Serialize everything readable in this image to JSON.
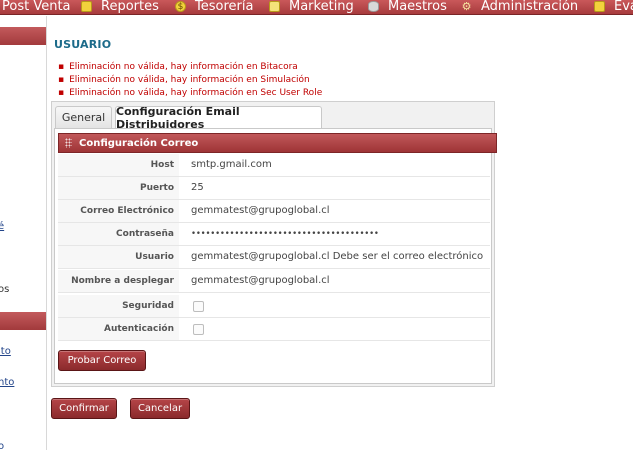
{
  "menu": {
    "items": [
      {
        "label": "Post Venta",
        "icon": "none"
      },
      {
        "label": "Reportes",
        "icon": "report-icon"
      },
      {
        "label": "Tesorería",
        "icon": "coin-icon"
      },
      {
        "label": "Marketing",
        "icon": "note-icon"
      },
      {
        "label": "Maestros",
        "icon": "database-icon"
      },
      {
        "label": "Administración",
        "icon": "gears-icon"
      },
      {
        "label": "Eva",
        "icon": "evaluation-icon"
      }
    ]
  },
  "sidebar": {
    "fragments": [
      "é",
      "os",
      "ito",
      "nto",
      "o"
    ]
  },
  "page": {
    "title": "Usuario",
    "errors": [
      "Eliminación no válida, hay información en Bitacora",
      "Eliminación no válida, hay información en Simulación",
      "Eliminación no válida, hay información en Sec User Role"
    ]
  },
  "tabs": [
    {
      "label": "General",
      "active": false
    },
    {
      "label": "Configuración Email Distribuidores",
      "active": true
    }
  ],
  "section": {
    "title": "Configuración Correo",
    "fields": {
      "host": {
        "label": "Host",
        "value": "smtp.gmail.com"
      },
      "puerto": {
        "label": "Puerto",
        "value": "25"
      },
      "correo": {
        "label": "Correo Electrónico",
        "value": "gemmatest@grupoglobal.cl"
      },
      "contrasena": {
        "label": "Contraseña",
        "value": "•••••••••••••••••••••••••••••••••••••••"
      },
      "usuario": {
        "label": "Usuario",
        "value": "gemmatest@grupoglobal.cl Debe ser el correo electrónico"
      },
      "nombre": {
        "label": "Nombre a desplegar",
        "value": "gemmatest@grupoglobal.cl"
      },
      "seguridad": {
        "label": "Seguridad",
        "checked": false
      },
      "autenticacion": {
        "label": "Autenticación",
        "checked": false
      }
    },
    "test_button": "Probar Correo"
  },
  "actions": {
    "confirm": "Confirmar",
    "cancel": "Cancelar"
  },
  "colors": {
    "brand": "#a73b3d",
    "title": "#1d6b8a",
    "error": "#c00000"
  }
}
